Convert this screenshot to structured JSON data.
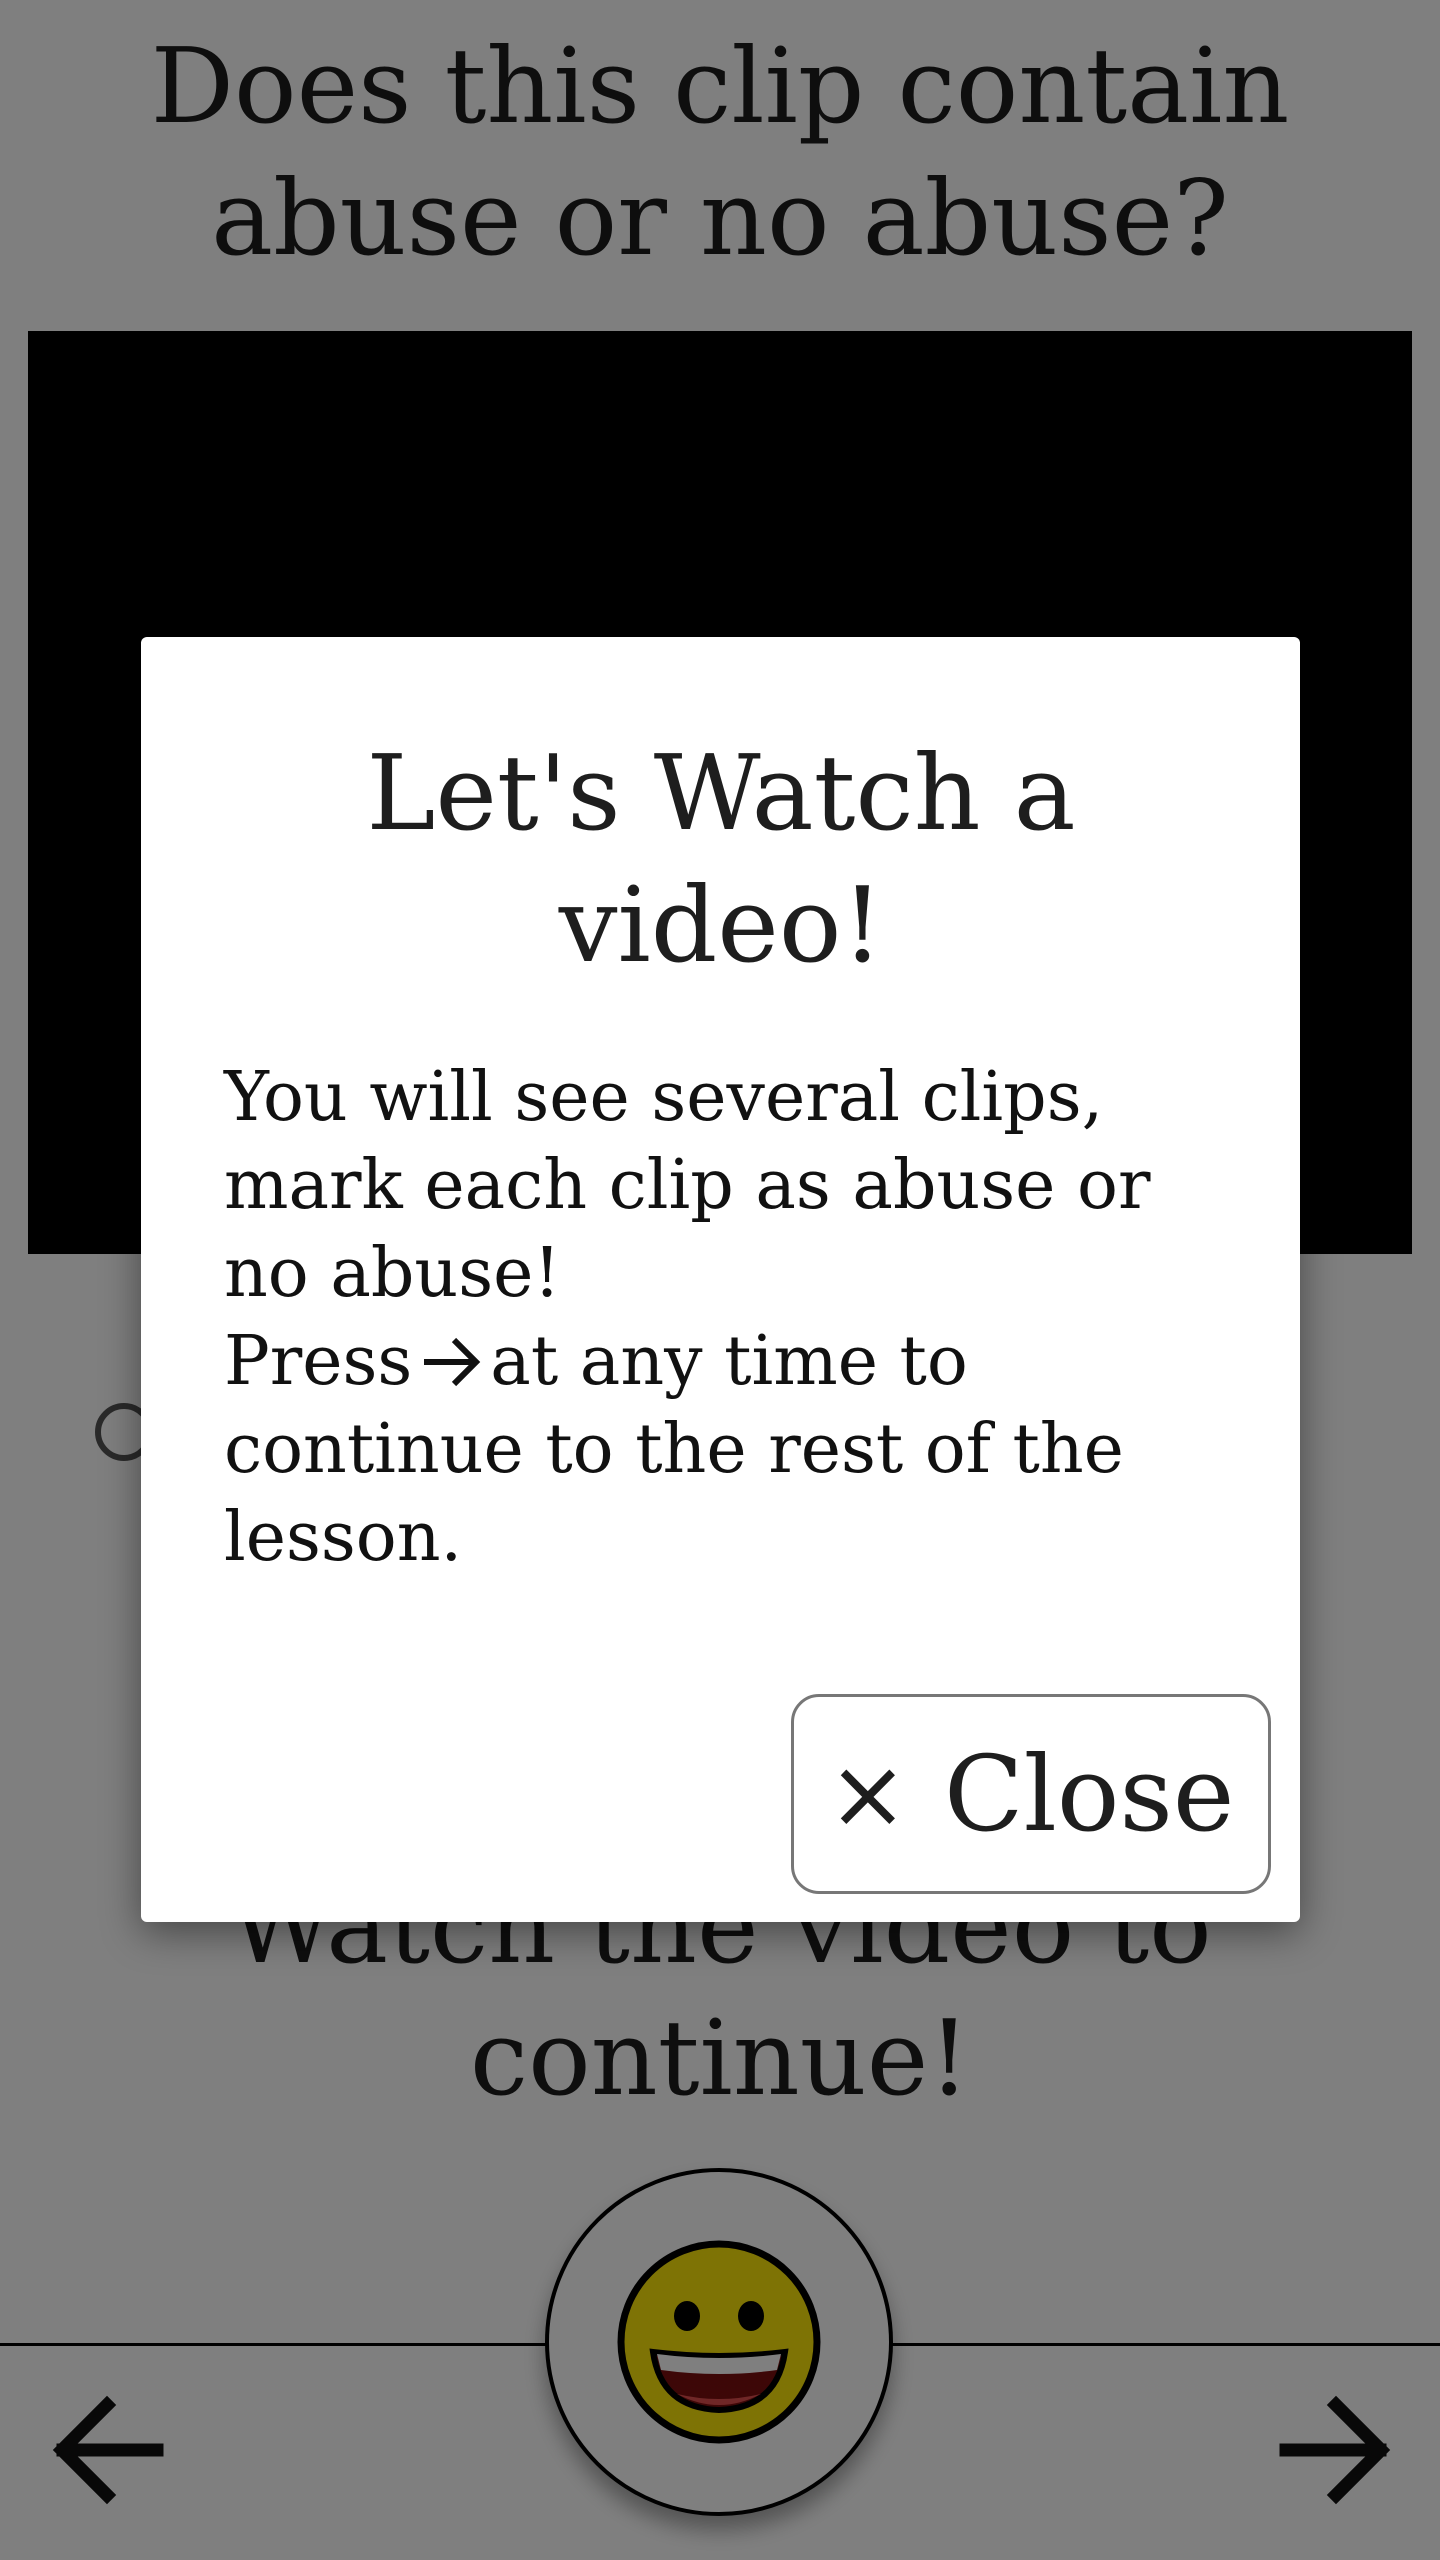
{
  "page": {
    "question": "Does this clip contain abuse or no abuse?",
    "watch_prompt": "Watch the video to continue!"
  },
  "modal": {
    "title": "Let's Watch a video!",
    "body_line1": "You will see several clips, mark each clip as abuse or no abuse!",
    "body_press": "Press",
    "body_rest": "at any time to continue to the rest of the lesson.",
    "close_icon": "×",
    "close_label": "Close"
  },
  "icons": {
    "back": "arrow-left-icon",
    "next": "arrow-right-icon",
    "mascot": "grinning-face-icon",
    "inline_arrow": "arrow-right-icon"
  },
  "colors": {
    "overlay": "rgba(0,0,0,0.5)",
    "video_background": "#000000",
    "mascot_face": "#fde60a"
  }
}
